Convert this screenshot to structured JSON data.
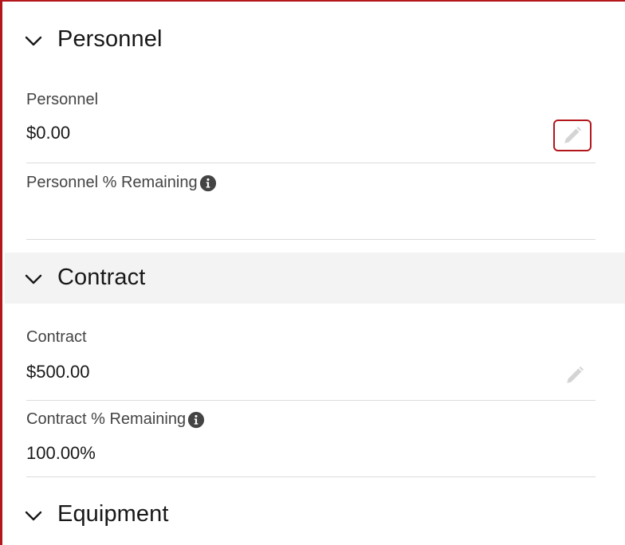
{
  "sections": [
    {
      "title": "Personnel",
      "fields": [
        {
          "label": "Personnel",
          "value": "$0.00",
          "editable": true
        },
        {
          "label": "Personnel % Remaining",
          "value": "",
          "info": true
        }
      ]
    },
    {
      "title": "Contract",
      "fields": [
        {
          "label": "Contract",
          "value": "$500.00",
          "editable": true
        },
        {
          "label": "Contract % Remaining",
          "value": "100.00%",
          "info": true
        }
      ]
    },
    {
      "title": "Equipment",
      "fields": []
    }
  ],
  "icons": {
    "section_toggle": "chevron-down-icon",
    "edit": "pencil-icon",
    "info": "info-icon"
  },
  "colors": {
    "focus_border": "#b3161b",
    "divider": "#dddbda",
    "header_shaded_bg": "#f3f3f3",
    "text_primary": "#181818",
    "text_label": "#444444",
    "icon_muted": "#c9c9c9",
    "info_icon": "#444444"
  }
}
